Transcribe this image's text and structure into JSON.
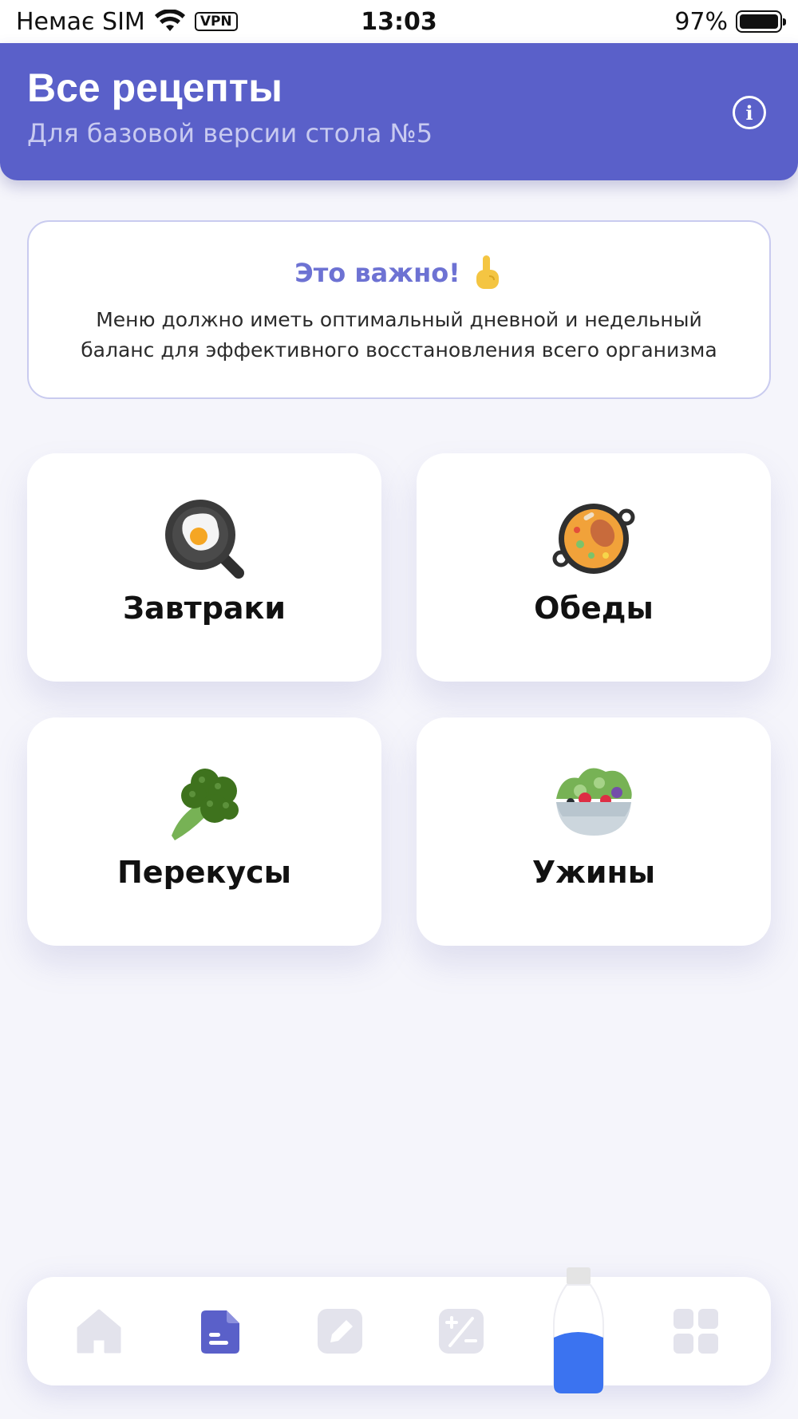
{
  "status_bar": {
    "carrier": "Немає SIM",
    "vpn": "VPN",
    "time": "13:03",
    "battery": "97%"
  },
  "header": {
    "title": "Все рецепты",
    "subtitle": "Для базовой версии стола №5",
    "info_icon": "i"
  },
  "notice": {
    "title": "Это важно!",
    "emoji": "☝",
    "text": "Меню должно иметь оптимальный дневной и недельный баланс для эффективного восстановления всего организма"
  },
  "categories": [
    {
      "label": "Завтраки",
      "icon": "frying-pan-egg-icon"
    },
    {
      "label": "Обеды",
      "icon": "paella-icon"
    },
    {
      "label": "Перекусы",
      "icon": "broccoli-icon"
    },
    {
      "label": "Ужины",
      "icon": "salad-icon"
    }
  ],
  "bottom_nav": {
    "items": [
      {
        "icon": "home-icon",
        "active": false
      },
      {
        "icon": "document-icon",
        "active": true
      },
      {
        "icon": "pencil-icon",
        "active": false
      },
      {
        "icon": "plus-minus-icon",
        "active": false
      },
      {
        "icon": "water-bottle-icon",
        "active": false
      },
      {
        "icon": "grid-icon",
        "active": false
      }
    ]
  },
  "colors": {
    "primary": "#5a60c9",
    "accent_text": "#6d72d3",
    "inactive_icon": "#e3e3ec",
    "water": "#3b73f0"
  }
}
